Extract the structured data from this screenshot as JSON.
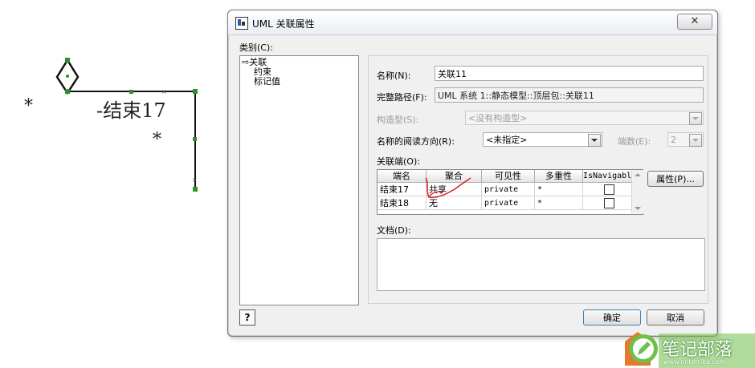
{
  "diagram": {
    "left_multiplicity": "*",
    "role_label": "-结束17",
    "right_multiplicity": "*"
  },
  "dialog": {
    "title": "UML 关联属性",
    "close_symbol": "✕",
    "category_label": "类别(C):",
    "category_items": [
      "关联",
      "约束",
      "标记值"
    ],
    "selected_category": "关联",
    "name_label": "名称(N):",
    "name_value": "关联11",
    "fullpath_label": "完整路径(F):",
    "fullpath_value": "UML 系统 1::静态模型::顶层包::关联11",
    "stereotype_label": "构造型(S):",
    "stereotype_value": "<没有构造型>",
    "reading_dir_label": "名称的阅读方向(R):",
    "reading_dir_value": "<未指定>",
    "ends_count_label": "端数(E):",
    "ends_count_value": "2",
    "association_ends_label": "关联端(O):",
    "table": {
      "headers": [
        "端名",
        "聚合",
        "可见性",
        "多重性",
        "IsNavigabl"
      ],
      "rows": [
        {
          "end": "结束17",
          "aggregation": "共享",
          "visibility": "private",
          "multiplicity": "*",
          "navigable": false
        },
        {
          "end": "结束18",
          "aggregation": "无",
          "visibility": "private",
          "multiplicity": "*",
          "navigable": false
        }
      ]
    },
    "properties_button": "属性(P)...",
    "documentation_label": "文档(D):",
    "ok_button": "确定",
    "cancel_button": "取消",
    "help_symbol": "?"
  },
  "watermark": {
    "text": "笔记部落",
    "url": "www.notetribe.com"
  },
  "colors": {
    "selection_dot": "#2f8f2f",
    "annotation_red": "#d9202a",
    "watermark_green": "#6fbf4a"
  }
}
